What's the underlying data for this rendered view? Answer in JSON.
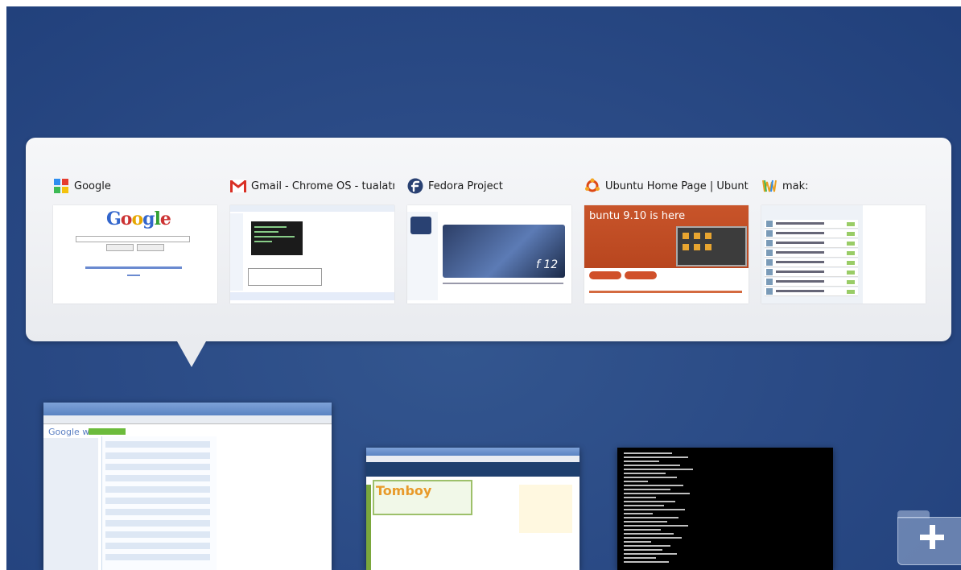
{
  "popup": {
    "tabs": [
      {
        "title": "Google",
        "icon": "google-icon"
      },
      {
        "title": "Gmail - Chrome OS - tualatri...",
        "icon": "gmail-icon"
      },
      {
        "title": "Fedora Project",
        "icon": "fedora-icon"
      },
      {
        "title": "Ubuntu Home Page | Ubuntu",
        "icon": "ubuntu-icon"
      },
      {
        "title": "mak:",
        "icon": "wave-icon"
      }
    ]
  },
  "thumbnails": {
    "fedora_badge": "f 12",
    "ubuntu_heading": "buntu 9.10 is here",
    "tomboy_logo": "Tomboy",
    "wave_logo": "Google wave"
  },
  "new_window": {
    "icon": "plus-icon"
  },
  "colors": {
    "background": "#2b4b86",
    "popup": "#eceef2",
    "ubuntu_orange": "#c8542a"
  }
}
